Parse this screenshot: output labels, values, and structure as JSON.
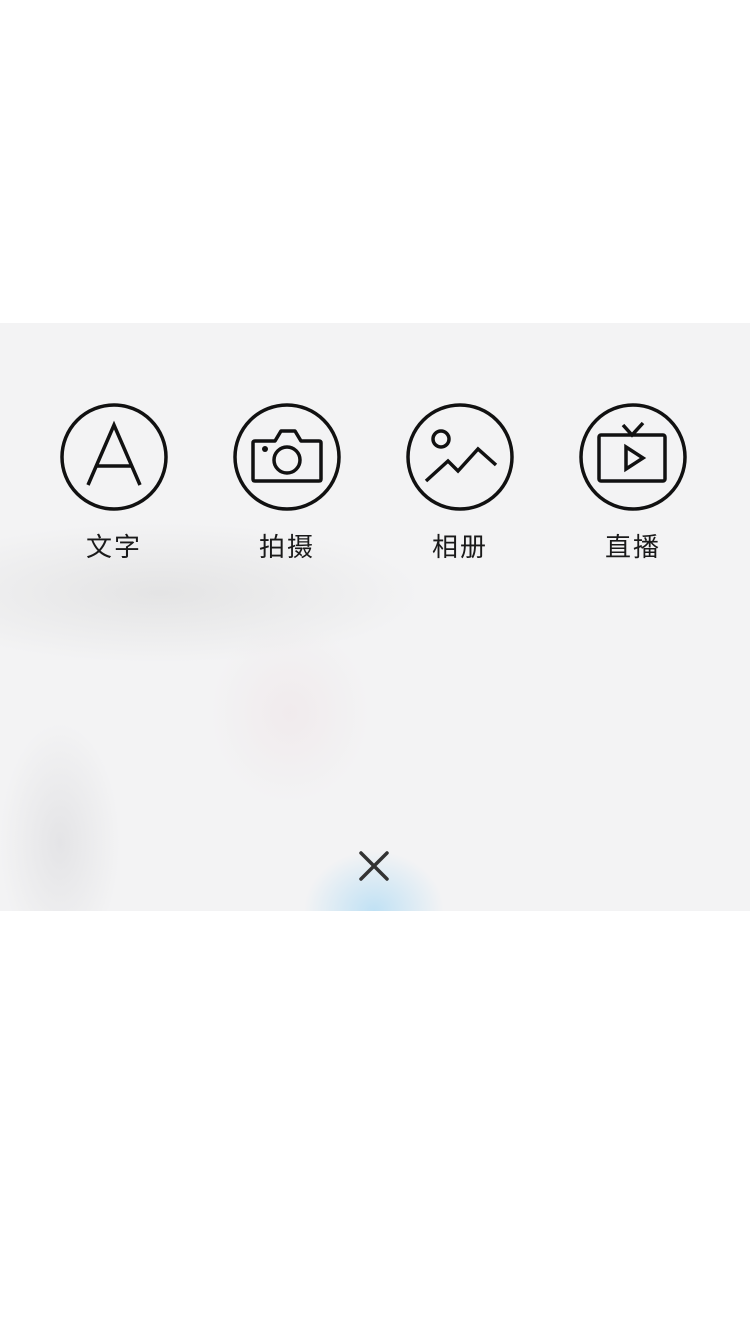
{
  "publish_menu": {
    "actions": [
      {
        "label": "文字",
        "icon": "text-icon"
      },
      {
        "label": "拍摄",
        "icon": "camera-icon"
      },
      {
        "label": "相册",
        "icon": "photo-album-icon"
      },
      {
        "label": "直播",
        "icon": "live-tv-icon"
      }
    ],
    "close_icon": "close-icon"
  },
  "colors": {
    "icon_stroke": "#111111",
    "label_text": "#1a1a1a",
    "sheet_background": "#f3f3f4",
    "close_glow": "#96d2f5"
  }
}
